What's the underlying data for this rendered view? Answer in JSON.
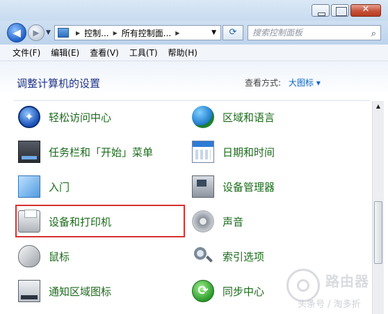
{
  "window": {
    "controls": [
      "minimize",
      "maximize",
      "close"
    ]
  },
  "nav": {
    "address_segments": [
      "控制...",
      "所有控制面..."
    ],
    "search_placeholder": "搜索控制面板"
  },
  "menu": {
    "items": [
      "文件(F)",
      "编辑(E)",
      "查看(V)",
      "工具(T)",
      "帮助(H)"
    ]
  },
  "main": {
    "heading": "调整计算机的设置",
    "view_by_label": "查看方式:",
    "view_by_value": "大图标 ▾",
    "items_left": [
      {
        "label": "轻松访问中心",
        "icon": "ease-of-access-icon"
      },
      {
        "label": "任务栏和「开始」菜单",
        "icon": "taskbar-icon"
      },
      {
        "label": "入门",
        "icon": "getting-started-icon"
      },
      {
        "label": "设备和打印机",
        "icon": "printer-icon",
        "highlighted": true
      },
      {
        "label": "鼠标",
        "icon": "mouse-icon"
      },
      {
        "label": "通知区域图标",
        "icon": "notification-icon"
      }
    ],
    "items_right": [
      {
        "label": "区域和语言",
        "icon": "globe-clock-icon"
      },
      {
        "label": "日期和时间",
        "icon": "calendar-icon"
      },
      {
        "label": "设备管理器",
        "icon": "device-manager-icon"
      },
      {
        "label": "声音",
        "icon": "speaker-icon"
      },
      {
        "label": "索引选项",
        "icon": "magnifier-icon"
      },
      {
        "label": "同步中心",
        "icon": "sync-icon"
      }
    ]
  },
  "watermark": {
    "title": "路由器",
    "subtitle": "头条号 / 淘多折"
  },
  "colors": {
    "item_label": "#1b6b1b",
    "heading": "#1e3287",
    "link": "#0b63c5",
    "highlight_box": "#d7312f"
  }
}
